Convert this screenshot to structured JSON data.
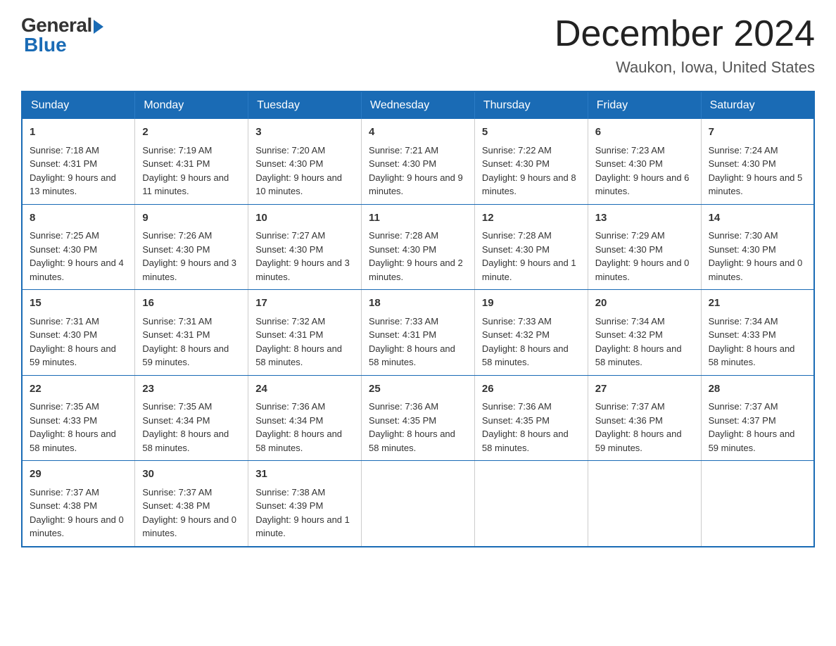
{
  "logo": {
    "general": "General",
    "blue": "Blue"
  },
  "title": "December 2024",
  "location": "Waukon, Iowa, United States",
  "days_of_week": [
    "Sunday",
    "Monday",
    "Tuesday",
    "Wednesday",
    "Thursday",
    "Friday",
    "Saturday"
  ],
  "weeks": [
    [
      {
        "day": 1,
        "sunrise": "7:18 AM",
        "sunset": "4:31 PM",
        "daylight": "9 hours and 13 minutes."
      },
      {
        "day": 2,
        "sunrise": "7:19 AM",
        "sunset": "4:31 PM",
        "daylight": "9 hours and 11 minutes."
      },
      {
        "day": 3,
        "sunrise": "7:20 AM",
        "sunset": "4:30 PM",
        "daylight": "9 hours and 10 minutes."
      },
      {
        "day": 4,
        "sunrise": "7:21 AM",
        "sunset": "4:30 PM",
        "daylight": "9 hours and 9 minutes."
      },
      {
        "day": 5,
        "sunrise": "7:22 AM",
        "sunset": "4:30 PM",
        "daylight": "9 hours and 8 minutes."
      },
      {
        "day": 6,
        "sunrise": "7:23 AM",
        "sunset": "4:30 PM",
        "daylight": "9 hours and 6 minutes."
      },
      {
        "day": 7,
        "sunrise": "7:24 AM",
        "sunset": "4:30 PM",
        "daylight": "9 hours and 5 minutes."
      }
    ],
    [
      {
        "day": 8,
        "sunrise": "7:25 AM",
        "sunset": "4:30 PM",
        "daylight": "9 hours and 4 minutes."
      },
      {
        "day": 9,
        "sunrise": "7:26 AM",
        "sunset": "4:30 PM",
        "daylight": "9 hours and 3 minutes."
      },
      {
        "day": 10,
        "sunrise": "7:27 AM",
        "sunset": "4:30 PM",
        "daylight": "9 hours and 3 minutes."
      },
      {
        "day": 11,
        "sunrise": "7:28 AM",
        "sunset": "4:30 PM",
        "daylight": "9 hours and 2 minutes."
      },
      {
        "day": 12,
        "sunrise": "7:28 AM",
        "sunset": "4:30 PM",
        "daylight": "9 hours and 1 minute."
      },
      {
        "day": 13,
        "sunrise": "7:29 AM",
        "sunset": "4:30 PM",
        "daylight": "9 hours and 0 minutes."
      },
      {
        "day": 14,
        "sunrise": "7:30 AM",
        "sunset": "4:30 PM",
        "daylight": "9 hours and 0 minutes."
      }
    ],
    [
      {
        "day": 15,
        "sunrise": "7:31 AM",
        "sunset": "4:30 PM",
        "daylight": "8 hours and 59 minutes."
      },
      {
        "day": 16,
        "sunrise": "7:31 AM",
        "sunset": "4:31 PM",
        "daylight": "8 hours and 59 minutes."
      },
      {
        "day": 17,
        "sunrise": "7:32 AM",
        "sunset": "4:31 PM",
        "daylight": "8 hours and 58 minutes."
      },
      {
        "day": 18,
        "sunrise": "7:33 AM",
        "sunset": "4:31 PM",
        "daylight": "8 hours and 58 minutes."
      },
      {
        "day": 19,
        "sunrise": "7:33 AM",
        "sunset": "4:32 PM",
        "daylight": "8 hours and 58 minutes."
      },
      {
        "day": 20,
        "sunrise": "7:34 AM",
        "sunset": "4:32 PM",
        "daylight": "8 hours and 58 minutes."
      },
      {
        "day": 21,
        "sunrise": "7:34 AM",
        "sunset": "4:33 PM",
        "daylight": "8 hours and 58 minutes."
      }
    ],
    [
      {
        "day": 22,
        "sunrise": "7:35 AM",
        "sunset": "4:33 PM",
        "daylight": "8 hours and 58 minutes."
      },
      {
        "day": 23,
        "sunrise": "7:35 AM",
        "sunset": "4:34 PM",
        "daylight": "8 hours and 58 minutes."
      },
      {
        "day": 24,
        "sunrise": "7:36 AM",
        "sunset": "4:34 PM",
        "daylight": "8 hours and 58 minutes."
      },
      {
        "day": 25,
        "sunrise": "7:36 AM",
        "sunset": "4:35 PM",
        "daylight": "8 hours and 58 minutes."
      },
      {
        "day": 26,
        "sunrise": "7:36 AM",
        "sunset": "4:35 PM",
        "daylight": "8 hours and 58 minutes."
      },
      {
        "day": 27,
        "sunrise": "7:37 AM",
        "sunset": "4:36 PM",
        "daylight": "8 hours and 59 minutes."
      },
      {
        "day": 28,
        "sunrise": "7:37 AM",
        "sunset": "4:37 PM",
        "daylight": "8 hours and 59 minutes."
      }
    ],
    [
      {
        "day": 29,
        "sunrise": "7:37 AM",
        "sunset": "4:38 PM",
        "daylight": "9 hours and 0 minutes."
      },
      {
        "day": 30,
        "sunrise": "7:37 AM",
        "sunset": "4:38 PM",
        "daylight": "9 hours and 0 minutes."
      },
      {
        "day": 31,
        "sunrise": "7:38 AM",
        "sunset": "4:39 PM",
        "daylight": "9 hours and 1 minute."
      },
      null,
      null,
      null,
      null
    ]
  ]
}
